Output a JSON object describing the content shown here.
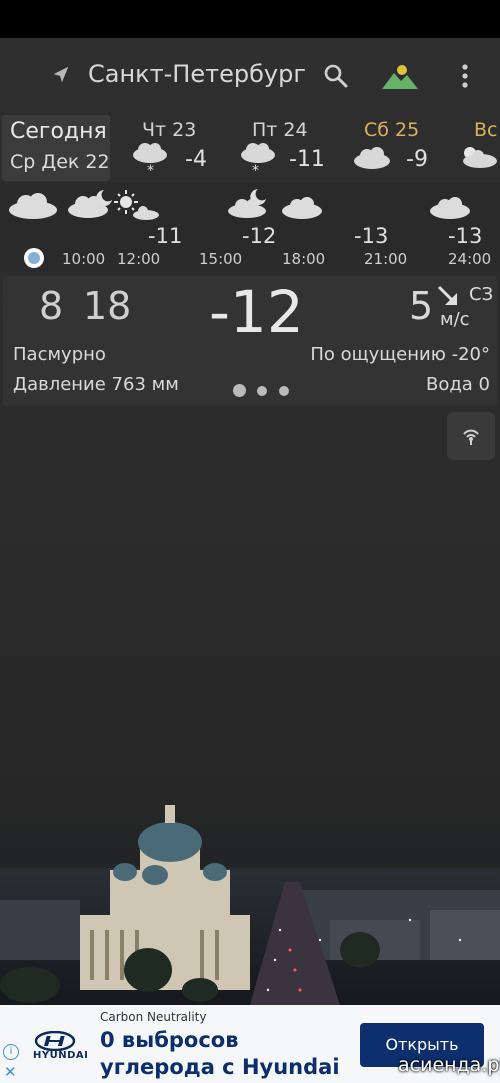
{
  "header": {
    "city": "Санкт-Петербург"
  },
  "today": {
    "label": "Сегодня",
    "date": "Ср Дек 22"
  },
  "days": [
    {
      "name": "Чт 23",
      "temp": "-4",
      "icon": "cloud-snow-icon",
      "color": "#d4d4d4"
    },
    {
      "name": "Пт 24",
      "temp": "-11",
      "icon": "cloud-snow-icon",
      "color": "#d4d4d4"
    },
    {
      "name": "Сб 25",
      "temp": "-9",
      "icon": "cloud-icon",
      "color": "#d9b35a"
    },
    {
      "name": "Вс",
      "temp": "",
      "icon": "partly-sunny-icon",
      "color": "#d9b35a"
    }
  ],
  "hourly": {
    "temps": [
      "-11",
      "-12",
      "-13",
      "-13"
    ],
    "times": [
      "10:00",
      "12:00",
      "15:00",
      "18:00",
      "21:00",
      "24:00"
    ]
  },
  "current": {
    "dawn": "8",
    "dusk": "18",
    "temp": "-12",
    "wind_speed": "5",
    "wind_dir": "СЗ",
    "wind_unit": "м/с",
    "condition": "Пасмурно",
    "feels_like": "По ощущению -20°",
    "pressure": "Давление 763 мм",
    "water": "Вода 0"
  },
  "ad": {
    "brand": "HYUNDAI",
    "small": "Carbon Neutrality",
    "headline": "0 выбросов углерода с Hyundai",
    "button": "Открыть",
    "info": "i",
    "close": "✕"
  },
  "watermark": "асиенда.ру"
}
